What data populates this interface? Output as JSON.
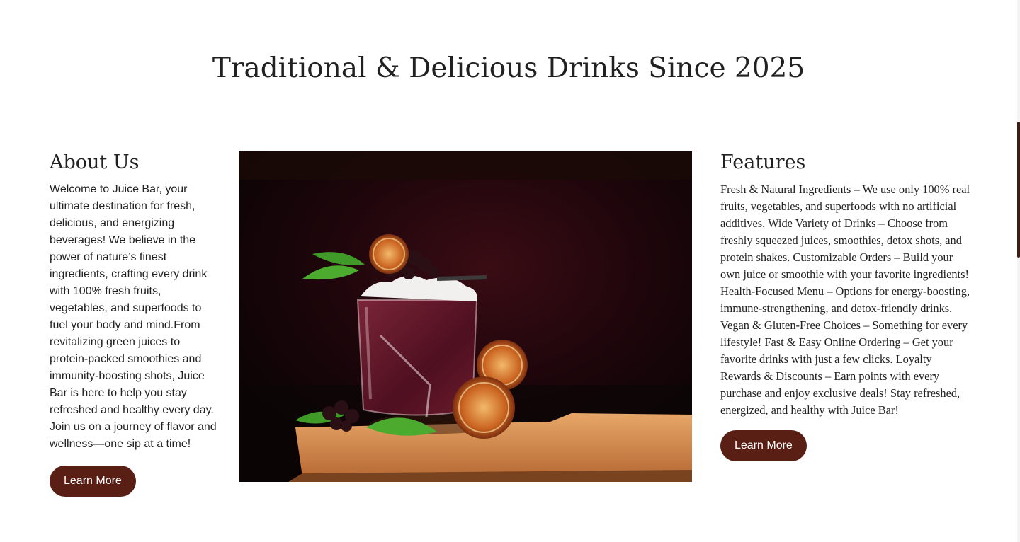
{
  "hero": {
    "title": "Traditional & Delicious Drinks Since 2025"
  },
  "about": {
    "heading": "About Us",
    "body": "Welcome to Juice Bar, your ultimate destination for fresh, delicious, and energizing beverages! We believe in the power of nature’s finest ingredients, crafting every drink with 100% fresh fruits, vegetables, and superfoods to fuel your body and mind.From revitalizing green juices to protein-packed smoothies and immunity-boosting shots, Juice Bar is here to help you stay refreshed and healthy every day. Join us on a journey of flavor and wellness—one sip at a time!",
    "button_label": "Learn More"
  },
  "features": {
    "heading": "Features",
    "body": "Fresh & Natural Ingredients – We use only 100% real fruits, vegetables, and superfoods with no artificial additives. Wide Variety of Drinks – Choose from freshly squeezed juices, smoothies, detox shots, and protein shakes. Customizable Orders – Build your own juice or smoothie with your favorite ingredients! Health-Focused Menu – Options for energy-boosting, immune-strengthening, and detox-friendly drinks. Vegan & Gluten-Free Choices – Something for every lifestyle! Fast & Easy Online Ordering – Get your favorite drinks with just a few clicks. Loyalty Rewards & Discounts – Earn points with every purchase and enjoy exclusive deals! Stay refreshed, energized, and healthy with Juice Bar!",
    "button_label": "Learn More"
  },
  "image": {
    "subject": "cocktail-glass-photo"
  },
  "colors": {
    "button_bg": "#5a1f14",
    "text": "#212121",
    "scrollbar_thumb": "#3b1d16"
  }
}
